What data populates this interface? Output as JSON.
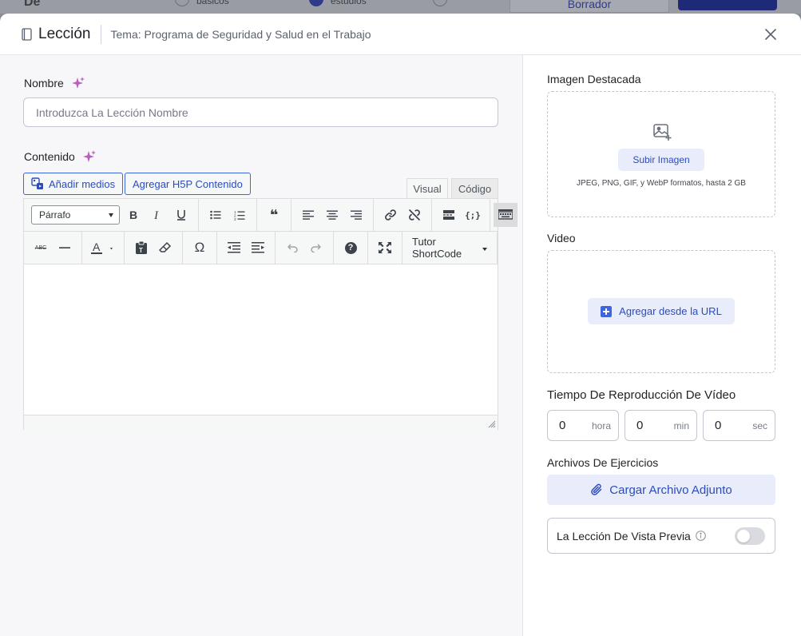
{
  "background": {
    "partial_label": "De",
    "radio_a_label": "básicos",
    "radio_b_label": "estudios",
    "draft_button": "Borrador"
  },
  "header": {
    "title": "Lección",
    "subtitle": "Tema: Programa de Seguridad y Salud en el Trabajo"
  },
  "form": {
    "name_label": "Nombre",
    "name_placeholder": "Introduzca La Lección Nombre",
    "name_value": "",
    "content_label": "Contenido"
  },
  "editor": {
    "add_media": "Añadir medios",
    "add_h5p": "Agregar H5P Contenido",
    "tab_visual": "Visual",
    "tab_code": "Código",
    "format_selected": "Párrafo",
    "shortcode_label": "Tutor ShortCode",
    "blockquote_glyph": "❝",
    "code_glyph": "{;}",
    "strike_glyph": "ABC",
    "omega_glyph": "Ω",
    "help_glyph": "?"
  },
  "sidebar": {
    "featured_image_label": "Imagen Destacada",
    "upload_image": "Subir Imagen",
    "image_formats_hint": "JPEG, PNG, GIF, y WebP formatos, hasta 2 GB",
    "video_label": "Video",
    "add_from_url": "Agregar desde la URL",
    "playback_label": "Tiempo De Reproducción De Vídeo",
    "time": [
      {
        "value": "0",
        "unit": "hora"
      },
      {
        "value": "0",
        "unit": "min"
      },
      {
        "value": "0",
        "unit": "sec"
      }
    ],
    "exercise_files_label": "Archivos De Ejercicios",
    "upload_attachment": "Cargar Archivo Adjunto",
    "preview_label": "La Lección De Vista Previa",
    "preview_enabled": false
  },
  "colors": {
    "accent": "#3e64de",
    "accent_text": "#2c4cbd",
    "accent_soft": "#e9edfb",
    "sparkle_start": "#e45ba0",
    "sparkle_end": "#8a63d2"
  }
}
